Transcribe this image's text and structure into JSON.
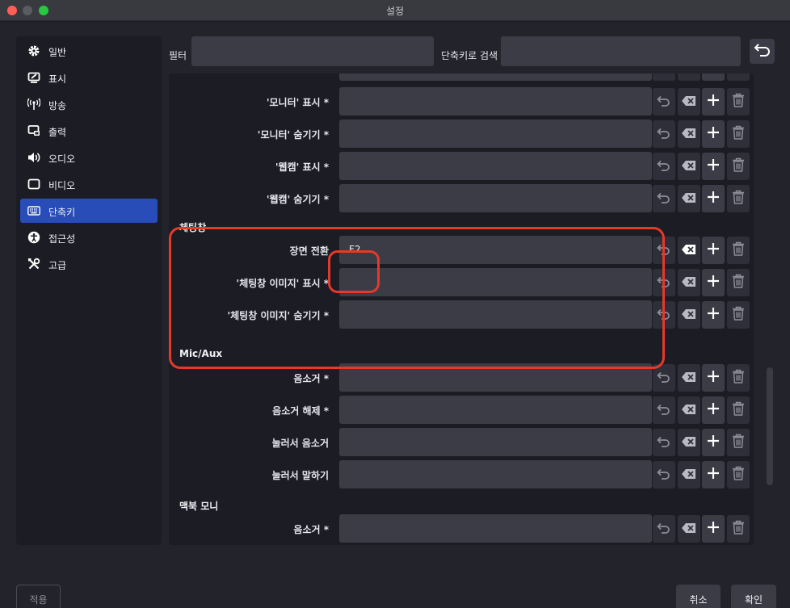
{
  "window": {
    "title": "설정"
  },
  "sidebar": {
    "items": [
      {
        "label": "일반",
        "icon": "gear-icon"
      },
      {
        "label": "표시",
        "icon": "display-icon"
      },
      {
        "label": "방송",
        "icon": "broadcast-icon"
      },
      {
        "label": "출력",
        "icon": "output-icon"
      },
      {
        "label": "오디오",
        "icon": "speaker-icon"
      },
      {
        "label": "비디오",
        "icon": "monitor-icon"
      },
      {
        "label": "단축키",
        "icon": "keyboard-icon",
        "active": true
      },
      {
        "label": "접근성",
        "icon": "accessibility-icon"
      },
      {
        "label": "고급",
        "icon": "tools-icon"
      }
    ]
  },
  "toolbar": {
    "filter_label": "필터",
    "filter_value": "",
    "search_label": "단축키로 검색",
    "search_value": ""
  },
  "hotkeys": {
    "rows_top": [
      {
        "label": "'모니터' 표시 *",
        "value": ""
      },
      {
        "label": "'모니터' 숨기기 *",
        "value": ""
      },
      {
        "label": "'웹캠' 표시 *",
        "value": ""
      },
      {
        "label": "'웹캠' 숨기기 *",
        "value": ""
      }
    ],
    "sections": [
      {
        "title": "체팅창",
        "rows": [
          {
            "label": "장면 전환",
            "value": "F2"
          },
          {
            "label": "'체팅창 이미지' 표시 *",
            "value": ""
          },
          {
            "label": "'체팅창 이미지' 숨기기 *",
            "value": ""
          }
        ]
      },
      {
        "title": "Mic/Aux",
        "rows": [
          {
            "label": "음소거 *",
            "value": ""
          },
          {
            "label": "음소거 해제 *",
            "value": ""
          },
          {
            "label": "눌러서 음소거",
            "value": ""
          },
          {
            "label": "눌러서 말하기",
            "value": ""
          }
        ]
      },
      {
        "title": "맥북 모니",
        "rows": [
          {
            "label": "음소거 *",
            "value": ""
          }
        ]
      }
    ]
  },
  "buttons": {
    "apply": "적용",
    "cancel": "취소",
    "ok": "확인"
  },
  "colors": {
    "accent": "#284cb8",
    "highlight": "#e8382a",
    "background": "#22232b"
  }
}
